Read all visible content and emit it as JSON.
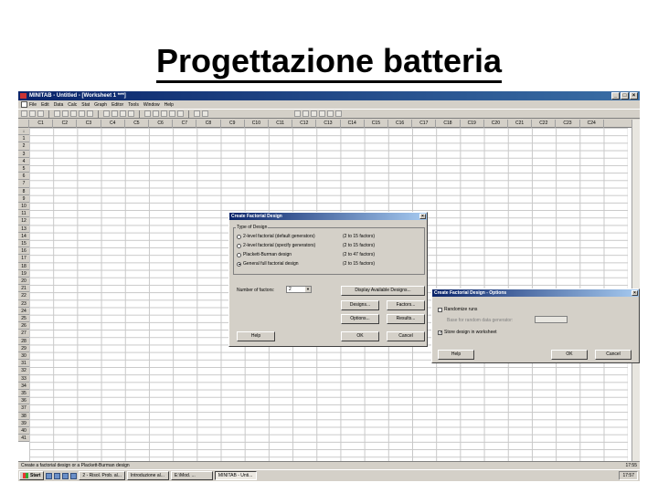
{
  "slide": {
    "title": "Progettazione batteria"
  },
  "window": {
    "title": "MINITAB - Untitled - [Worksheet 1 ***]",
    "menu": [
      "File",
      "Edit",
      "Data",
      "Calc",
      "Stat",
      "Graph",
      "Editor",
      "Tools",
      "Window",
      "Help"
    ]
  },
  "worksheet": {
    "columns": [
      "C1",
      "C2",
      "C3",
      "C4",
      "C5",
      "C6",
      "C7",
      "C8",
      "C9",
      "C10",
      "C11",
      "C12",
      "C13",
      "C14",
      "C15",
      "C16",
      "C17",
      "C18",
      "C19",
      "C20",
      "C21",
      "C22",
      "C23",
      "C24"
    ],
    "rows": [
      "↓",
      "1",
      "2",
      "3",
      "4",
      "5",
      "6",
      "7",
      "8",
      "9",
      "10",
      "11",
      "12",
      "13",
      "14",
      "15",
      "16",
      "17",
      "18",
      "19",
      "20",
      "21",
      "22",
      "23",
      "24",
      "25",
      "26",
      "27",
      "28",
      "29",
      "30",
      "31",
      "32",
      "33",
      "34",
      "35",
      "36",
      "37",
      "38",
      "39",
      "40",
      "41"
    ]
  },
  "dialog_main": {
    "title": "Create Factorial Design",
    "group_label": "Type of Design",
    "options": [
      {
        "label": "2-level factorial (default generators)",
        "range": "(2 to 15 factors)",
        "selected": false
      },
      {
        "label": "2-level factorial (specify generators)",
        "range": "(2 to 15 factors)",
        "selected": false
      },
      {
        "label": "Plackett-Burman design",
        "range": "(2 to 47 factors)",
        "selected": false
      },
      {
        "label": "General full factorial design",
        "range": "(2 to 15 factors)",
        "selected": true
      }
    ],
    "factors_label": "Number of factors:",
    "factors_value": "2",
    "buttons": {
      "display": "Display Available Designs...",
      "designs": "Designs...",
      "factors": "Factors...",
      "options": "Options...",
      "results": "Results...",
      "help": "Help",
      "ok": "OK",
      "cancel": "Cancel"
    }
  },
  "dialog_options": {
    "title": "Create Factorial Design - Options",
    "randomize": {
      "label": "Randomize runs",
      "checked": false
    },
    "seed_label": "Base for random data generator:",
    "store": {
      "label": "Store design in worksheet",
      "checked": true
    },
    "buttons": {
      "help": "Help",
      "ok": "OK",
      "cancel": "Cancel"
    }
  },
  "status": {
    "text": "Create a factorial design or a Plackett-Burman design",
    "time": "17:55"
  },
  "taskbar": {
    "start": "Start",
    "items": [
      "2 - Risol. Prob. al...",
      "Introduzione al...",
      "E:\\Mod. ...",
      "MINITAB - Unti..."
    ],
    "tray": "17:57"
  }
}
